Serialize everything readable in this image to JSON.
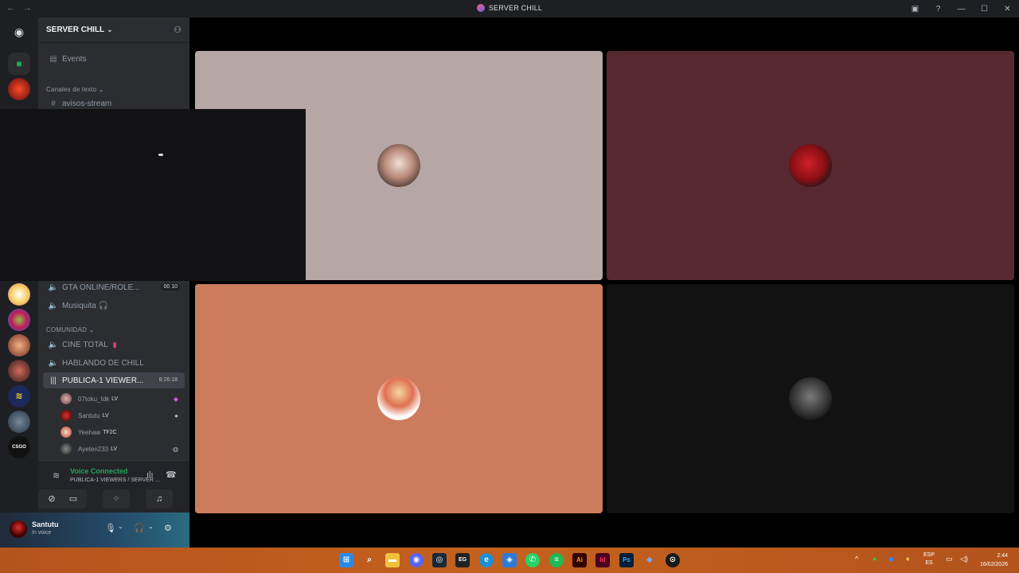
{
  "window": {
    "title": "SERVER CHILL"
  },
  "server": {
    "name": "SERVER CHILL"
  },
  "channels": {
    "events": "Events",
    "text_category": "Canales de texto",
    "avisos": "avisos-stream",
    "gta": "GTA ONLINE/ROLE...",
    "gta_badge": "00 10",
    "musiquita": "Musiquita 🎧",
    "community_category": "COMUNIDAD",
    "cine": "CINE TOTAL",
    "hablando": "HABLANDO DE CHILL",
    "publica": "PUBLICA-1 VIEWER...",
    "publica_timer": "8:26:18"
  },
  "voice_users": [
    {
      "name": "07toku_Idk",
      "tag": "LV"
    },
    {
      "name": "Santutu",
      "tag": "LV"
    },
    {
      "name": "Yeehaw",
      "tag": "TF2C"
    },
    {
      "name": "Ayeten233",
      "tag": "LV"
    }
  ],
  "voice_panel": {
    "status": "Voice Connected",
    "location": "PUBLICA-1 VIEWERS / SERVER ..."
  },
  "user_panel": {
    "name": "Santutu",
    "status": "In voice"
  },
  "taskbar": {
    "lang_top": "ESP",
    "lang_bottom": "ES",
    "time": "2:44",
    "date": "16/02/2026"
  },
  "colors": {
    "tile1": "#b7a6a6",
    "tile2": "#582830",
    "tile3": "#cc7c5c",
    "tile4": "#121212",
    "voice_green": "#23a55a",
    "sidebar": "#2b2d31",
    "rail": "#1e1f22"
  }
}
